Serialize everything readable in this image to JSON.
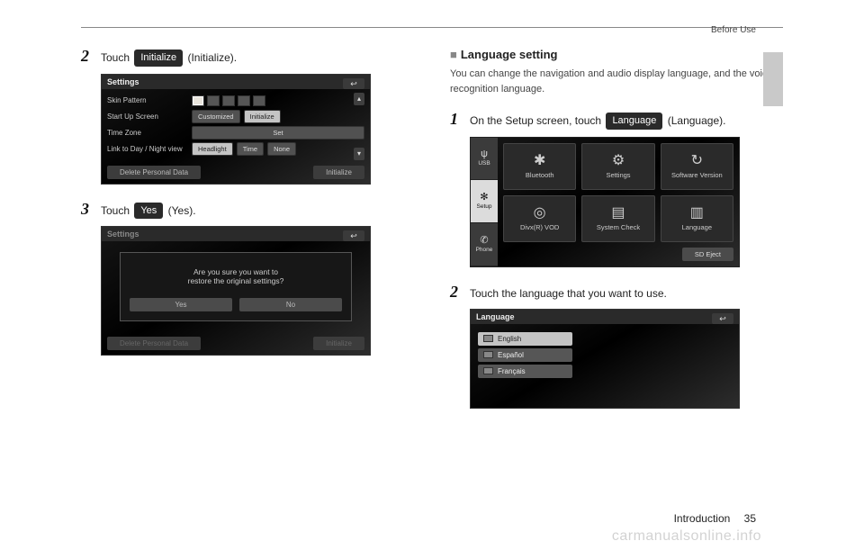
{
  "header": {
    "section": "Before Use"
  },
  "footer": {
    "chapter": "Introduction",
    "page": "35"
  },
  "watermark": "carmanualsonline.info",
  "left": {
    "step2": {
      "num": "2",
      "text_a": "Touch ",
      "chip": "Initialize",
      "text_b": " (Initialize)."
    },
    "shot_settings": {
      "title": "Settings",
      "rows": {
        "skin": {
          "label": "Skin Pattern"
        },
        "startup": {
          "label": "Start Up Screen",
          "btn1": "Customized",
          "btn2": "Initialize"
        },
        "timezone": {
          "label": "Time Zone",
          "btn": "Set"
        },
        "link": {
          "label": "Link to Day / Night view",
          "b1": "Headlight",
          "b2": "Time",
          "b3": "None"
        }
      },
      "footer": {
        "left": "Delete Personal Data",
        "right": "Initialize"
      }
    },
    "step3": {
      "num": "3",
      "text_a": "Touch ",
      "chip": "Yes",
      "text_b": " (Yes)."
    },
    "shot_dialog": {
      "title": "Settings",
      "line1": "Are you sure you want to",
      "line2": "restore the original settings?",
      "yes": "Yes",
      "no": "No",
      "footer": {
        "left": "Delete Personal Data",
        "right": "Initialize"
      }
    }
  },
  "right": {
    "section_title": "Language setting",
    "intro": "You can change the navigation and audio display language, and the voice recognition language.",
    "step1": {
      "num": "1",
      "text_a": "On the Setup screen, touch ",
      "chip": "Language",
      "text_b": " (Language)."
    },
    "shot_setup": {
      "side": {
        "usb": "USB",
        "setup": "Setup",
        "phone": "Phone"
      },
      "cells": {
        "bt": "Bluetooth",
        "settings": "Settings",
        "sv": "Software Version",
        "divx": "Divx(R) VOD",
        "sc": "System Check",
        "lang": "Language"
      },
      "eject": "SD Eject"
    },
    "step2": {
      "num": "2",
      "text": "Touch the language that you want to use."
    },
    "shot_lang": {
      "title": "Language",
      "items": {
        "en": "English",
        "es": "Español",
        "fr": "Français"
      }
    }
  }
}
